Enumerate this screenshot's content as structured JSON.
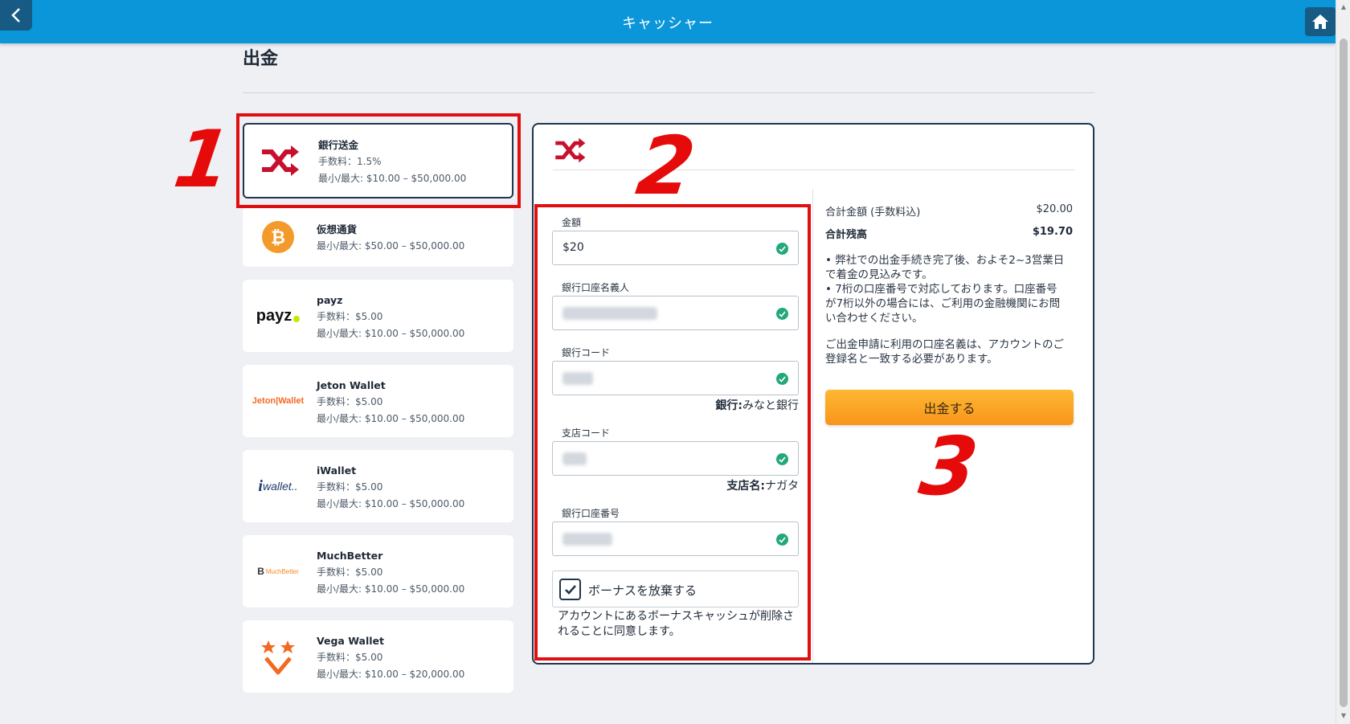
{
  "header": {
    "title": "キャッシャー"
  },
  "page": {
    "title": "出金"
  },
  "methods": [
    {
      "name": "銀行送金",
      "fee": "手数料：1.5%",
      "range": "最小/最大: $10.00 – $50,000.00",
      "icon": "shuffle-icon",
      "selected": true
    },
    {
      "name": "仮想通貨",
      "range": "最小/最大: $50.00 – $50,000.00",
      "icon": "bitcoin-icon"
    },
    {
      "name": "payz",
      "fee": "手数料：$5.00",
      "range": "最小/最大: $10.00 – $50,000.00",
      "icon": "payz-logo",
      "logo_text": "payz"
    },
    {
      "name": "Jeton Wallet",
      "fee": "手数料：$5.00",
      "range": "最小/最大: $10.00 – $50,000.00",
      "icon": "jeton-logo",
      "logo_text": "Jeton|Wallet"
    },
    {
      "name": "iWallet",
      "fee": "手数料：$5.00",
      "range": "最小/最大: $10.00 – $50,000.00",
      "icon": "iwallet-logo",
      "logo_text": "wallet.."
    },
    {
      "name": "MuchBetter",
      "fee": "手数料：$5.00",
      "range": "最小/最大: $10.00 – $50,000.00",
      "icon": "muchbetter-logo",
      "logo_text": "MuchBetter"
    },
    {
      "name": "Vega Wallet",
      "fee": "手数料：$5.00",
      "range": "最小/最大: $10.00 – $20,000.00",
      "icon": "vega-logo"
    }
  ],
  "form": {
    "amount": {
      "label": "金額",
      "value": "$20"
    },
    "account_holder": {
      "label": "銀行口座名義人"
    },
    "bank_code": {
      "label": "銀行コード",
      "helper_key": "銀行:",
      "helper_value": "みなと銀行"
    },
    "branch_code": {
      "label": "支店コード",
      "helper_key": "支店名:",
      "helper_value": "ナガタ"
    },
    "account_number": {
      "label": "銀行口座番号"
    },
    "bonus_forfeit": {
      "label": "ボーナスを放棄する",
      "checked": true,
      "note": "アカウントにあるボーナスキャッシュが削除されることに同意します。"
    }
  },
  "summary": {
    "total_label": "合計金額 (手数料込)",
    "total_value": "$20.00",
    "balance_label": "合計残高",
    "balance_value": "$19.70",
    "note1_line1": "• 弊社での出金手続き完了後、およそ2~3営業日",
    "note1_line2": "で着金の見込みです。",
    "note2_line1": "• 7桁の口座番号で対応しております。口座番号",
    "note2_line2": "が7桁以外の場合には、ご利用の金融機関にお問",
    "note2_line3": "い合わせください。",
    "note3_line1": "ご出金申請に利用の口座名義は、アカウントのご",
    "note3_line2": "登録名と一致する必要があります。",
    "button": "出金する"
  },
  "annotations": [
    "1",
    "2",
    "3"
  ],
  "colors": {
    "header": "#0a96d8",
    "accent_red": "#c8102e",
    "annotation_red": "#e10f0f",
    "button": "#f7a21f",
    "valid_green": "#23a87a"
  }
}
